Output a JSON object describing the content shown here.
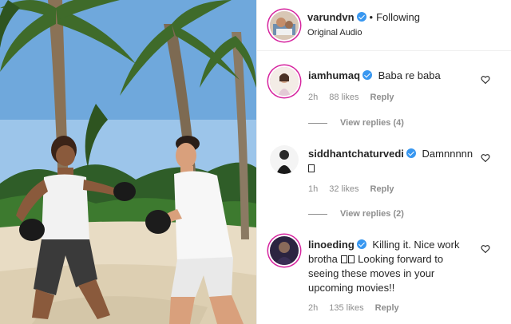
{
  "post": {
    "username": "varundvn",
    "separator": "•",
    "follow_status": "Following",
    "audio": "Original Audio"
  },
  "comments": [
    {
      "username": "iamhumaq",
      "text": "Baba re baba",
      "time": "2h",
      "likes": "88 likes",
      "reply_label": "Reply",
      "view_replies": "View replies (4)"
    },
    {
      "username": "siddhantchaturvedi",
      "text": "Damnnnnn",
      "time": "1h",
      "likes": "32 likes",
      "reply_label": "Reply",
      "view_replies": "View replies (2)"
    },
    {
      "username": "linoeding",
      "text_part1": "Killing it. Nice work brotha",
      "text_part2": "Looking forward to seeing these moves in your upcoming movies!!",
      "time": "2h",
      "likes": "135 likes",
      "reply_label": "Reply"
    }
  ],
  "icons": {
    "verified": "verified-badge-icon",
    "like": "heart-icon"
  },
  "colors": {
    "verified": "#3897f0",
    "muted": "#8e8e8e",
    "text": "#262626"
  }
}
